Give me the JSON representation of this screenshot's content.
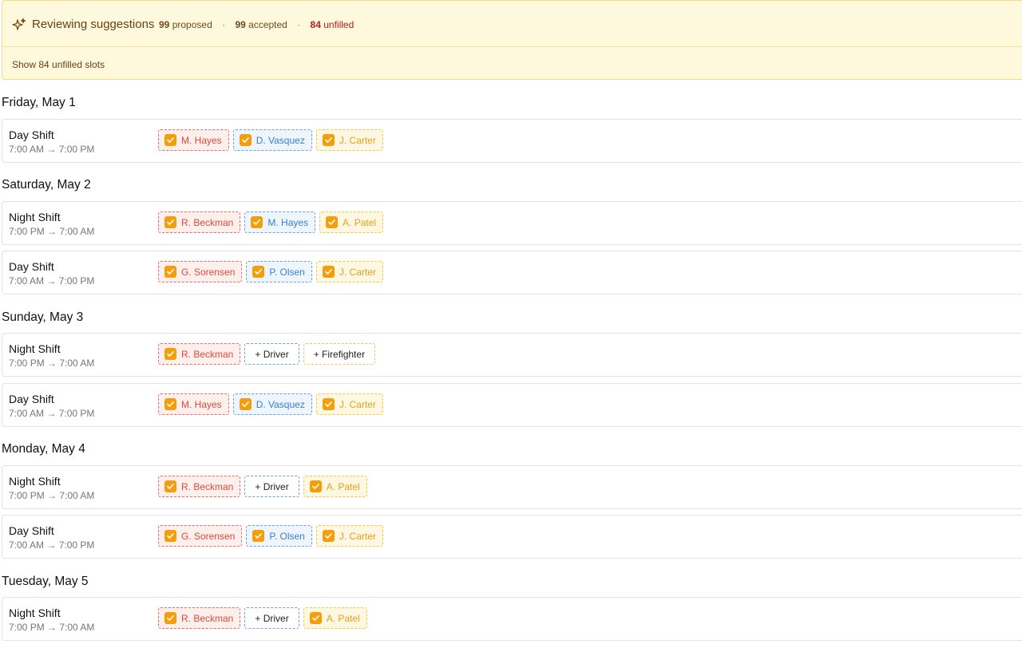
{
  "banner": {
    "title": "Reviewing suggestions",
    "proposed_count": "99",
    "proposed_label": "proposed",
    "accepted_count": "99",
    "accepted_label": "accepted",
    "unfilled_count": "84",
    "unfilled_label": "unfilled",
    "separator": "·",
    "show_unfilled_link": "Show 84 unfilled slots",
    "icon": "sparkles-icon"
  },
  "days": [
    {
      "heading": "Friday, May 1",
      "shifts": [
        {
          "name": "Day Shift",
          "time": "7:00 AM → 7:00 PM",
          "chips": [
            {
              "kind": "person",
              "color": "red",
              "label": "M. Hayes"
            },
            {
              "kind": "person",
              "color": "blue",
              "label": "D. Vasquez"
            },
            {
              "kind": "person",
              "color": "yellow",
              "label": "J. Carter"
            }
          ]
        }
      ]
    },
    {
      "heading": "Saturday, May 2",
      "shifts": [
        {
          "name": "Night Shift",
          "time": "7:00 PM → 7:00 AM",
          "chips": [
            {
              "kind": "person",
              "color": "red",
              "label": "R. Beckman"
            },
            {
              "kind": "person",
              "color": "blue",
              "label": "M. Hayes"
            },
            {
              "kind": "person",
              "color": "yellow",
              "label": "A. Patel"
            }
          ]
        },
        {
          "name": "Day Shift",
          "time": "7:00 AM → 7:00 PM",
          "chips": [
            {
              "kind": "person",
              "color": "red",
              "label": "G. Sorensen"
            },
            {
              "kind": "person",
              "color": "blue",
              "label": "P. Olsen"
            },
            {
              "kind": "person",
              "color": "yellow",
              "label": "J. Carter"
            }
          ]
        }
      ]
    },
    {
      "heading": "Sunday, May 3",
      "shifts": [
        {
          "name": "Night Shift",
          "time": "7:00 PM → 7:00 AM",
          "chips": [
            {
              "kind": "person",
              "color": "red",
              "label": "R. Beckman"
            },
            {
              "kind": "add",
              "color": "blue",
              "label": "+ Driver"
            },
            {
              "kind": "add",
              "color": "yellow",
              "label": "+ Firefighter"
            }
          ]
        },
        {
          "name": "Day Shift",
          "time": "7:00 AM → 7:00 PM",
          "chips": [
            {
              "kind": "person",
              "color": "red",
              "label": "M. Hayes"
            },
            {
              "kind": "person",
              "color": "blue",
              "label": "D. Vasquez"
            },
            {
              "kind": "person",
              "color": "yellow",
              "label": "J. Carter"
            }
          ]
        }
      ]
    },
    {
      "heading": "Monday, May 4",
      "shifts": [
        {
          "name": "Night Shift",
          "time": "7:00 PM → 7:00 AM",
          "chips": [
            {
              "kind": "person",
              "color": "red",
              "label": "R. Beckman"
            },
            {
              "kind": "add",
              "color": "blue",
              "label": "+ Driver"
            },
            {
              "kind": "person",
              "color": "yellow",
              "label": "A. Patel"
            }
          ]
        },
        {
          "name": "Day Shift",
          "time": "7:00 AM → 7:00 PM",
          "chips": [
            {
              "kind": "person",
              "color": "red",
              "label": "G. Sorensen"
            },
            {
              "kind": "person",
              "color": "blue",
              "label": "P. Olsen"
            },
            {
              "kind": "person",
              "color": "yellow",
              "label": "J. Carter"
            }
          ]
        }
      ]
    },
    {
      "heading": "Tuesday, May 5",
      "shifts": [
        {
          "name": "Night Shift",
          "time": "7:00 PM → 7:00 AM",
          "chips": [
            {
              "kind": "person",
              "color": "red",
              "label": "R. Beckman"
            },
            {
              "kind": "add",
              "color": "blue",
              "label": "+ Driver"
            },
            {
              "kind": "person",
              "color": "yellow",
              "label": "A. Patel"
            }
          ]
        }
      ]
    }
  ]
}
